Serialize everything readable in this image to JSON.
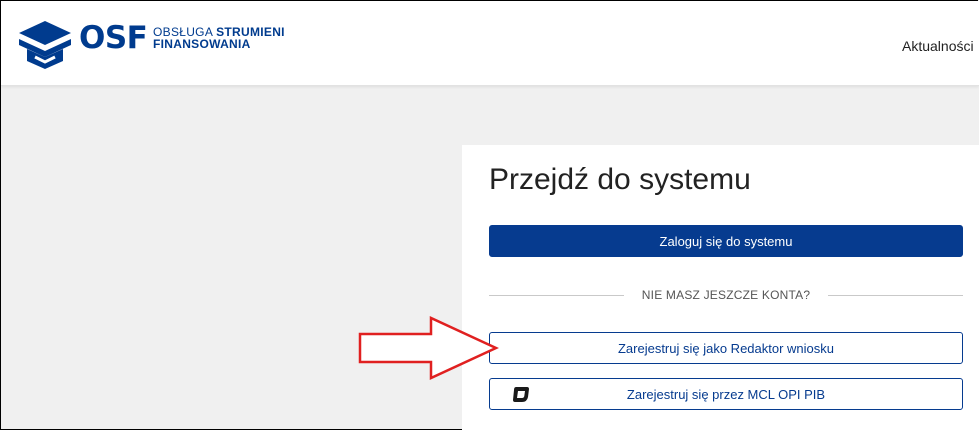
{
  "header": {
    "logo": {
      "name": "OSF",
      "subtitle_line1": "OBSŁUGA",
      "subtitle_line1_bold": "STRUMIENI",
      "subtitle_line2": "FINANSOWANIA"
    },
    "nav": {
      "news_label": "Aktualności"
    }
  },
  "panel": {
    "title": "Przejdź do systemu",
    "login_button": "Zaloguj się do systemu",
    "no_account_label": "NIE MASZ JESZCZE KONTA?",
    "register_editor_button": "Zarejestruj się jako Redaktor wniosku",
    "register_mcl_button": "Zarejestruj się przez MCL OPI PIB"
  },
  "icons": [
    "osf-logo-icon",
    "mcl-logo-icon",
    "red-arrow-annotation"
  ],
  "colors": {
    "brand_blue": "#063b8f",
    "annotation_red": "#e02020",
    "page_background": "#f0f0f0"
  }
}
